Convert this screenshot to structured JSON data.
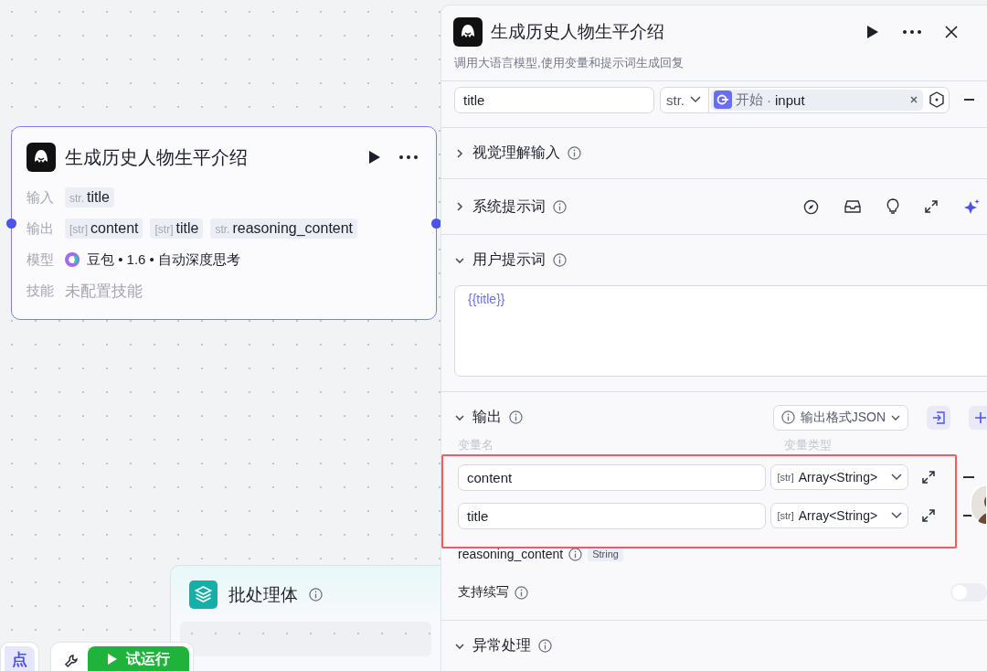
{
  "canvas": {
    "node": {
      "title": "生成历史人物生平介绍",
      "rows": [
        {
          "label": "输入",
          "kind": "tags",
          "tags": [
            {
              "type": "str.",
              "name": "title"
            }
          ]
        },
        {
          "label": "输出",
          "kind": "tags",
          "tags": [
            {
              "type": "[str]",
              "name": "content"
            },
            {
              "type": "[str]",
              "name": "title"
            },
            {
              "type": "str.",
              "name": "reasoning_content"
            }
          ]
        },
        {
          "label": "模型",
          "kind": "model",
          "value": "豆包 • 1.6 • 自动深度思考"
        },
        {
          "label": "技能",
          "kind": "empty",
          "value": "未配置技能"
        }
      ]
    },
    "batch_node": {
      "title": "批处理体"
    },
    "toolbar": {
      "add_node_label": "点",
      "run_button": "试运行"
    }
  },
  "panel": {
    "title": "生成历史人物生平介绍",
    "description": "调用大语言模型,使用变量和提示词生成回复",
    "input_row": {
      "name": "title",
      "type": "str.",
      "source_node": "开始",
      "separator": "·",
      "source_var": "input"
    },
    "vision_input": {
      "title": "视觉理解输入",
      "expanded": false
    },
    "system_prompt": {
      "title": "系统提示词",
      "expanded": false
    },
    "user_prompt": {
      "title": "用户提示词",
      "expanded": true,
      "text": "{{title}}"
    },
    "output": {
      "title": "输出",
      "expanded": true,
      "format_button": "输出格式JSON",
      "columns": [
        "变量名",
        "变量类型"
      ],
      "rows": [
        {
          "name": "content",
          "type_tag": "[str]",
          "type": "Array<String>"
        },
        {
          "name": "title",
          "type_tag": "[str]",
          "type": "Array<String>"
        }
      ],
      "extra": {
        "name": "reasoning_content",
        "type": "String"
      },
      "continue_writing": {
        "label": "支持续写",
        "on": false
      }
    },
    "error_handling": {
      "title": "异常处理",
      "expanded": true
    }
  }
}
